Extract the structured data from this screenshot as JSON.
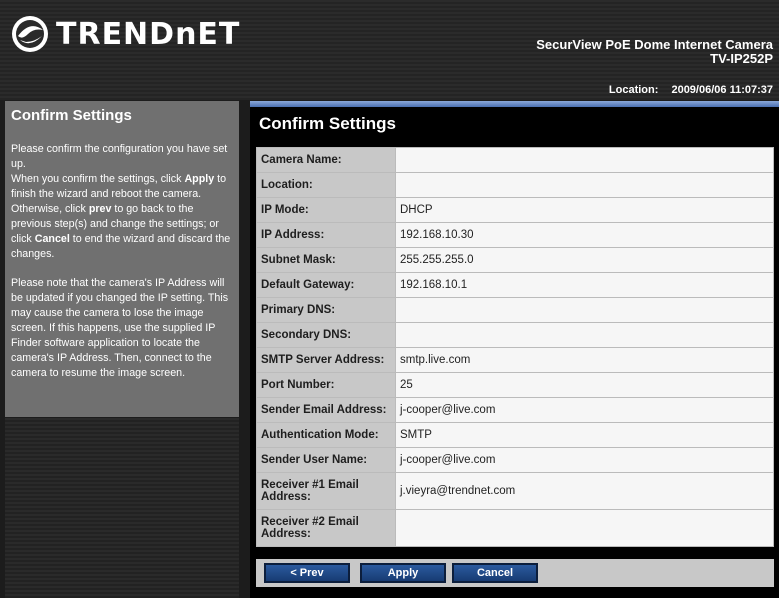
{
  "header": {
    "logo_text": "TRENDnET",
    "product_line1": "SecurView PoE Dome Internet Camera",
    "product_line2": "TV-IP252P",
    "location_label": "Location:",
    "datetime": "2009/06/06 11:07:37"
  },
  "sidebar": {
    "title": "Confirm Settings",
    "para1_a": "Please confirm the configuration you have set up.",
    "para1_b": "When you confirm the settings, click ",
    "para1_apply": "Apply",
    "para1_c": " to finish the wizard and reboot the camera. Otherwise, click ",
    "para1_prev": "prev",
    "para1_d": " to go back to the previous step(s) and change the settings; or click ",
    "para1_cancel": "Cancel",
    "para1_e": " to end the wizard and discard the changes.",
    "para2": "Please note that the camera's IP Address will be updated if you changed the IP setting. This may cause the camera to lose the image screen. If this happens, use the supplied IP Finder software application to locate the camera's IP Address. Then, connect to the camera to resume the image screen."
  },
  "main": {
    "title": "Confirm Settings",
    "rows": [
      {
        "label": "Camera Name:",
        "value": ""
      },
      {
        "label": "Location:",
        "value": ""
      },
      {
        "label": "IP Mode:",
        "value": "DHCP"
      },
      {
        "label": "IP Address:",
        "value": "192.168.10.30"
      },
      {
        "label": "Subnet Mask:",
        "value": "255.255.255.0"
      },
      {
        "label": "Default Gateway:",
        "value": "192.168.10.1"
      },
      {
        "label": "Primary DNS:",
        "value": ""
      },
      {
        "label": "Secondary DNS:",
        "value": ""
      },
      {
        "label": "SMTP Server Address:",
        "value": "smtp.live.com"
      },
      {
        "label": "Port Number:",
        "value": "25"
      },
      {
        "label": "Sender Email Address:",
        "value": "j-cooper@live.com"
      },
      {
        "label": "Authentication Mode:",
        "value": "SMTP"
      },
      {
        "label": "Sender User Name:",
        "value": "j-cooper@live.com"
      },
      {
        "label": "Receiver #1 Email Address:",
        "value": "j.vieyra@trendnet.com"
      },
      {
        "label": "Receiver #2 Email Address:",
        "value": ""
      }
    ]
  },
  "buttons": {
    "prev": "< Prev",
    "apply": "Apply",
    "cancel": "Cancel"
  },
  "colors": {
    "sidebar_bg": "#707070",
    "label_bg": "#c8c8c8",
    "button_blue": "#1f4a8a"
  }
}
